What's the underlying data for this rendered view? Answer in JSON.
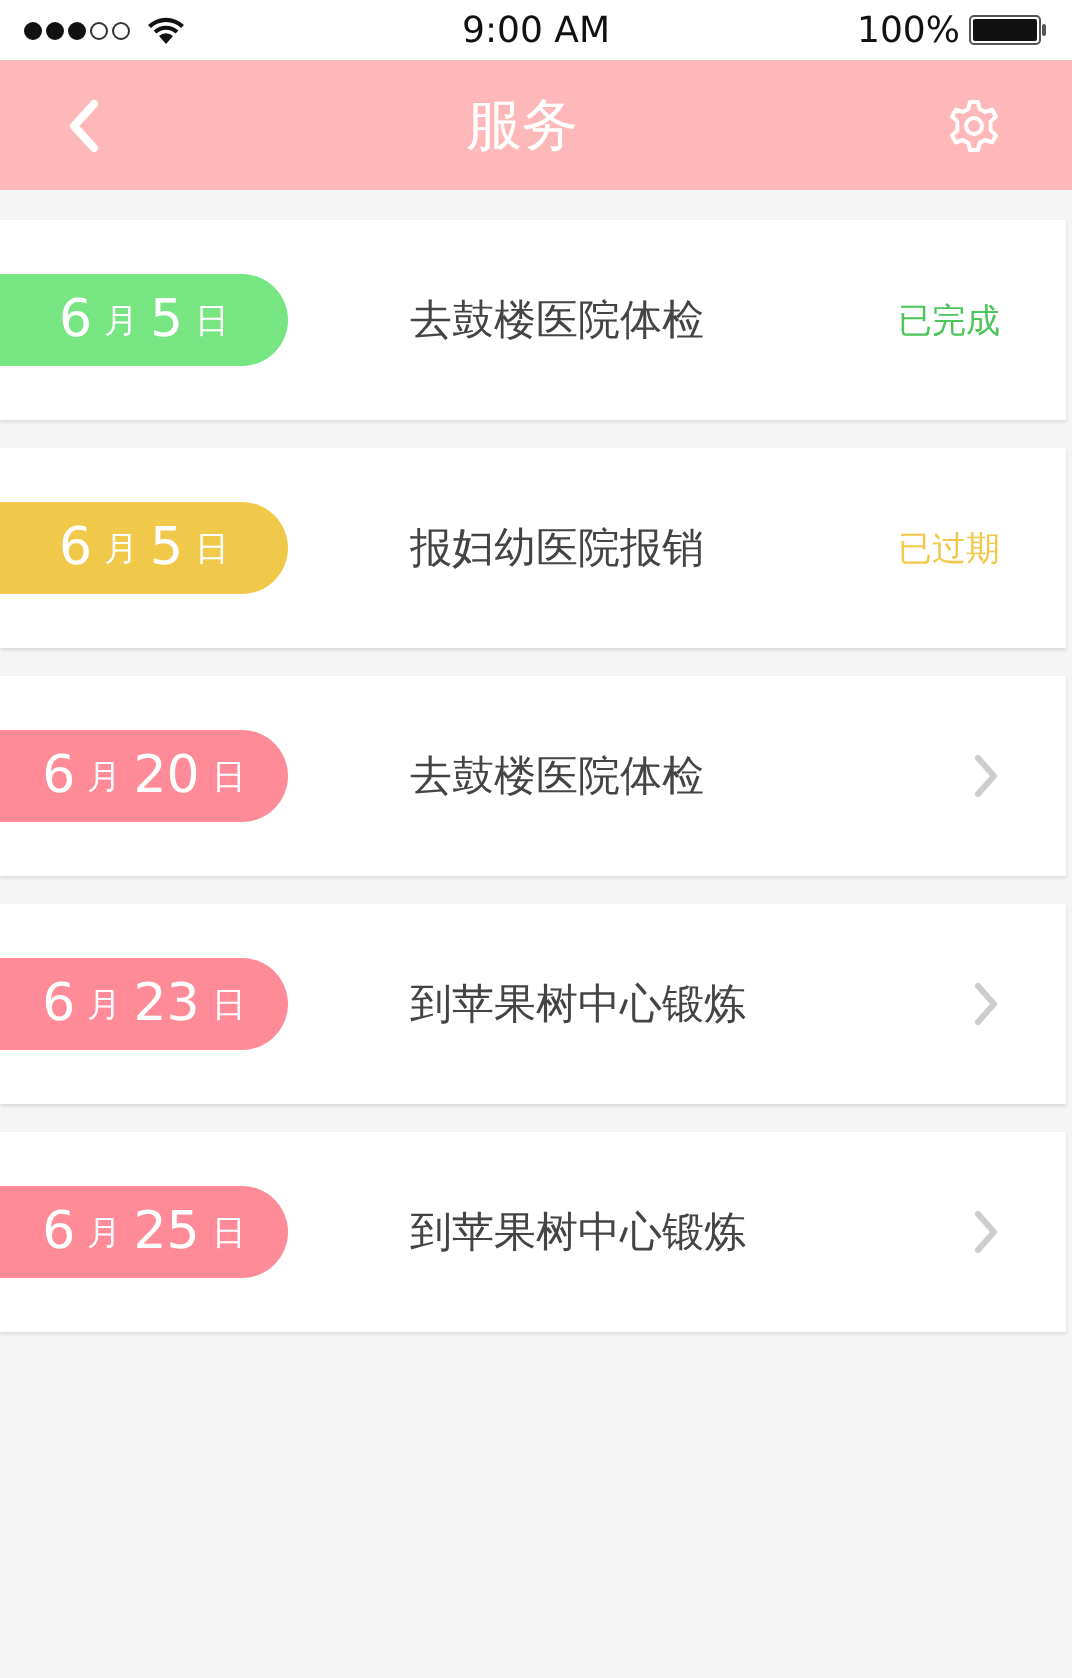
{
  "status_bar": {
    "time": "9:00 AM",
    "battery": "100%",
    "signal_bars": [
      {
        "on": true
      },
      {
        "on": true
      },
      {
        "on": true
      },
      {
        "on": false
      },
      {
        "on": false
      }
    ]
  },
  "nav": {
    "title": "服务"
  },
  "items": [
    {
      "month": "6",
      "month_unit": "月",
      "day": "5",
      "day_unit": "日",
      "color": "#78e583",
      "title": "去鼓楼医院体检",
      "kind": "status",
      "status": {
        "text": "已完成",
        "color": "#4cc65a"
      }
    },
    {
      "month": "6",
      "month_unit": "月",
      "day": "5",
      "day_unit": "日",
      "color": "#f0c84a",
      "title": "报妇幼医院报销",
      "kind": "status",
      "status": {
        "text": "已过期",
        "color": "#f0c84a"
      }
    },
    {
      "month": "6",
      "month_unit": "月",
      "day": "20",
      "day_unit": "日",
      "color": "#ff8a98",
      "title": "去鼓楼医院体检",
      "kind": "arrow"
    },
    {
      "month": "6",
      "month_unit": "月",
      "day": "23",
      "day_unit": "日",
      "color": "#ff8a98",
      "title": "到苹果树中心锻炼",
      "kind": "arrow"
    },
    {
      "month": "6",
      "month_unit": "月",
      "day": "25",
      "day_unit": "日",
      "color": "#ff8a98",
      "title": "到苹果树中心锻炼",
      "kind": "arrow"
    }
  ]
}
